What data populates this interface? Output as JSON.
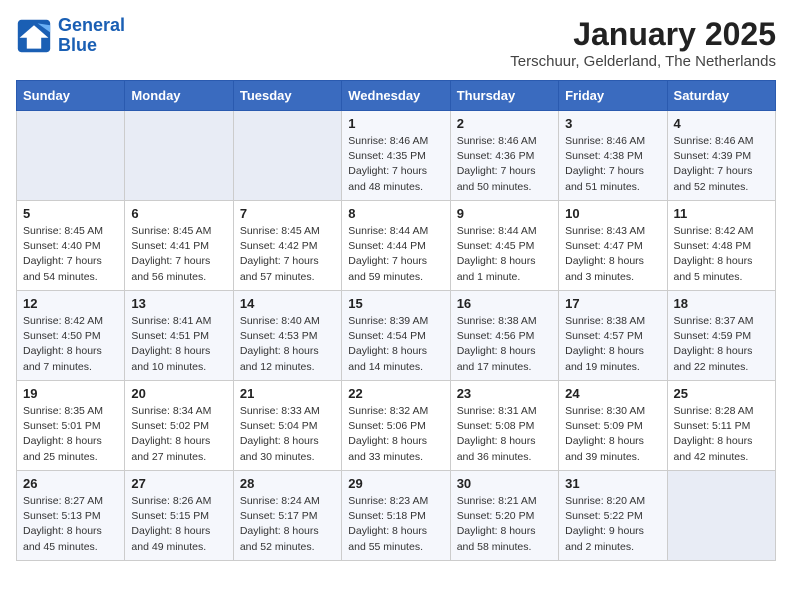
{
  "logo": {
    "line1": "General",
    "line2": "Blue"
  },
  "title": "January 2025",
  "subtitle": "Terschuur, Gelderland, The Netherlands",
  "days_of_week": [
    "Sunday",
    "Monday",
    "Tuesday",
    "Wednesday",
    "Thursday",
    "Friday",
    "Saturday"
  ],
  "weeks": [
    [
      {
        "num": "",
        "info": ""
      },
      {
        "num": "",
        "info": ""
      },
      {
        "num": "",
        "info": ""
      },
      {
        "num": "1",
        "info": "Sunrise: 8:46 AM\nSunset: 4:35 PM\nDaylight: 7 hours\nand 48 minutes."
      },
      {
        "num": "2",
        "info": "Sunrise: 8:46 AM\nSunset: 4:36 PM\nDaylight: 7 hours\nand 50 minutes."
      },
      {
        "num": "3",
        "info": "Sunrise: 8:46 AM\nSunset: 4:38 PM\nDaylight: 7 hours\nand 51 minutes."
      },
      {
        "num": "4",
        "info": "Sunrise: 8:46 AM\nSunset: 4:39 PM\nDaylight: 7 hours\nand 52 minutes."
      }
    ],
    [
      {
        "num": "5",
        "info": "Sunrise: 8:45 AM\nSunset: 4:40 PM\nDaylight: 7 hours\nand 54 minutes."
      },
      {
        "num": "6",
        "info": "Sunrise: 8:45 AM\nSunset: 4:41 PM\nDaylight: 7 hours\nand 56 minutes."
      },
      {
        "num": "7",
        "info": "Sunrise: 8:45 AM\nSunset: 4:42 PM\nDaylight: 7 hours\nand 57 minutes."
      },
      {
        "num": "8",
        "info": "Sunrise: 8:44 AM\nSunset: 4:44 PM\nDaylight: 7 hours\nand 59 minutes."
      },
      {
        "num": "9",
        "info": "Sunrise: 8:44 AM\nSunset: 4:45 PM\nDaylight: 8 hours\nand 1 minute."
      },
      {
        "num": "10",
        "info": "Sunrise: 8:43 AM\nSunset: 4:47 PM\nDaylight: 8 hours\nand 3 minutes."
      },
      {
        "num": "11",
        "info": "Sunrise: 8:42 AM\nSunset: 4:48 PM\nDaylight: 8 hours\nand 5 minutes."
      }
    ],
    [
      {
        "num": "12",
        "info": "Sunrise: 8:42 AM\nSunset: 4:50 PM\nDaylight: 8 hours\nand 7 minutes."
      },
      {
        "num": "13",
        "info": "Sunrise: 8:41 AM\nSunset: 4:51 PM\nDaylight: 8 hours\nand 10 minutes."
      },
      {
        "num": "14",
        "info": "Sunrise: 8:40 AM\nSunset: 4:53 PM\nDaylight: 8 hours\nand 12 minutes."
      },
      {
        "num": "15",
        "info": "Sunrise: 8:39 AM\nSunset: 4:54 PM\nDaylight: 8 hours\nand 14 minutes."
      },
      {
        "num": "16",
        "info": "Sunrise: 8:38 AM\nSunset: 4:56 PM\nDaylight: 8 hours\nand 17 minutes."
      },
      {
        "num": "17",
        "info": "Sunrise: 8:38 AM\nSunset: 4:57 PM\nDaylight: 8 hours\nand 19 minutes."
      },
      {
        "num": "18",
        "info": "Sunrise: 8:37 AM\nSunset: 4:59 PM\nDaylight: 8 hours\nand 22 minutes."
      }
    ],
    [
      {
        "num": "19",
        "info": "Sunrise: 8:35 AM\nSunset: 5:01 PM\nDaylight: 8 hours\nand 25 minutes."
      },
      {
        "num": "20",
        "info": "Sunrise: 8:34 AM\nSunset: 5:02 PM\nDaylight: 8 hours\nand 27 minutes."
      },
      {
        "num": "21",
        "info": "Sunrise: 8:33 AM\nSunset: 5:04 PM\nDaylight: 8 hours\nand 30 minutes."
      },
      {
        "num": "22",
        "info": "Sunrise: 8:32 AM\nSunset: 5:06 PM\nDaylight: 8 hours\nand 33 minutes."
      },
      {
        "num": "23",
        "info": "Sunrise: 8:31 AM\nSunset: 5:08 PM\nDaylight: 8 hours\nand 36 minutes."
      },
      {
        "num": "24",
        "info": "Sunrise: 8:30 AM\nSunset: 5:09 PM\nDaylight: 8 hours\nand 39 minutes."
      },
      {
        "num": "25",
        "info": "Sunrise: 8:28 AM\nSunset: 5:11 PM\nDaylight: 8 hours\nand 42 minutes."
      }
    ],
    [
      {
        "num": "26",
        "info": "Sunrise: 8:27 AM\nSunset: 5:13 PM\nDaylight: 8 hours\nand 45 minutes."
      },
      {
        "num": "27",
        "info": "Sunrise: 8:26 AM\nSunset: 5:15 PM\nDaylight: 8 hours\nand 49 minutes."
      },
      {
        "num": "28",
        "info": "Sunrise: 8:24 AM\nSunset: 5:17 PM\nDaylight: 8 hours\nand 52 minutes."
      },
      {
        "num": "29",
        "info": "Sunrise: 8:23 AM\nSunset: 5:18 PM\nDaylight: 8 hours\nand 55 minutes."
      },
      {
        "num": "30",
        "info": "Sunrise: 8:21 AM\nSunset: 5:20 PM\nDaylight: 8 hours\nand 58 minutes."
      },
      {
        "num": "31",
        "info": "Sunrise: 8:20 AM\nSunset: 5:22 PM\nDaylight: 9 hours\nand 2 minutes."
      },
      {
        "num": "",
        "info": ""
      }
    ]
  ]
}
